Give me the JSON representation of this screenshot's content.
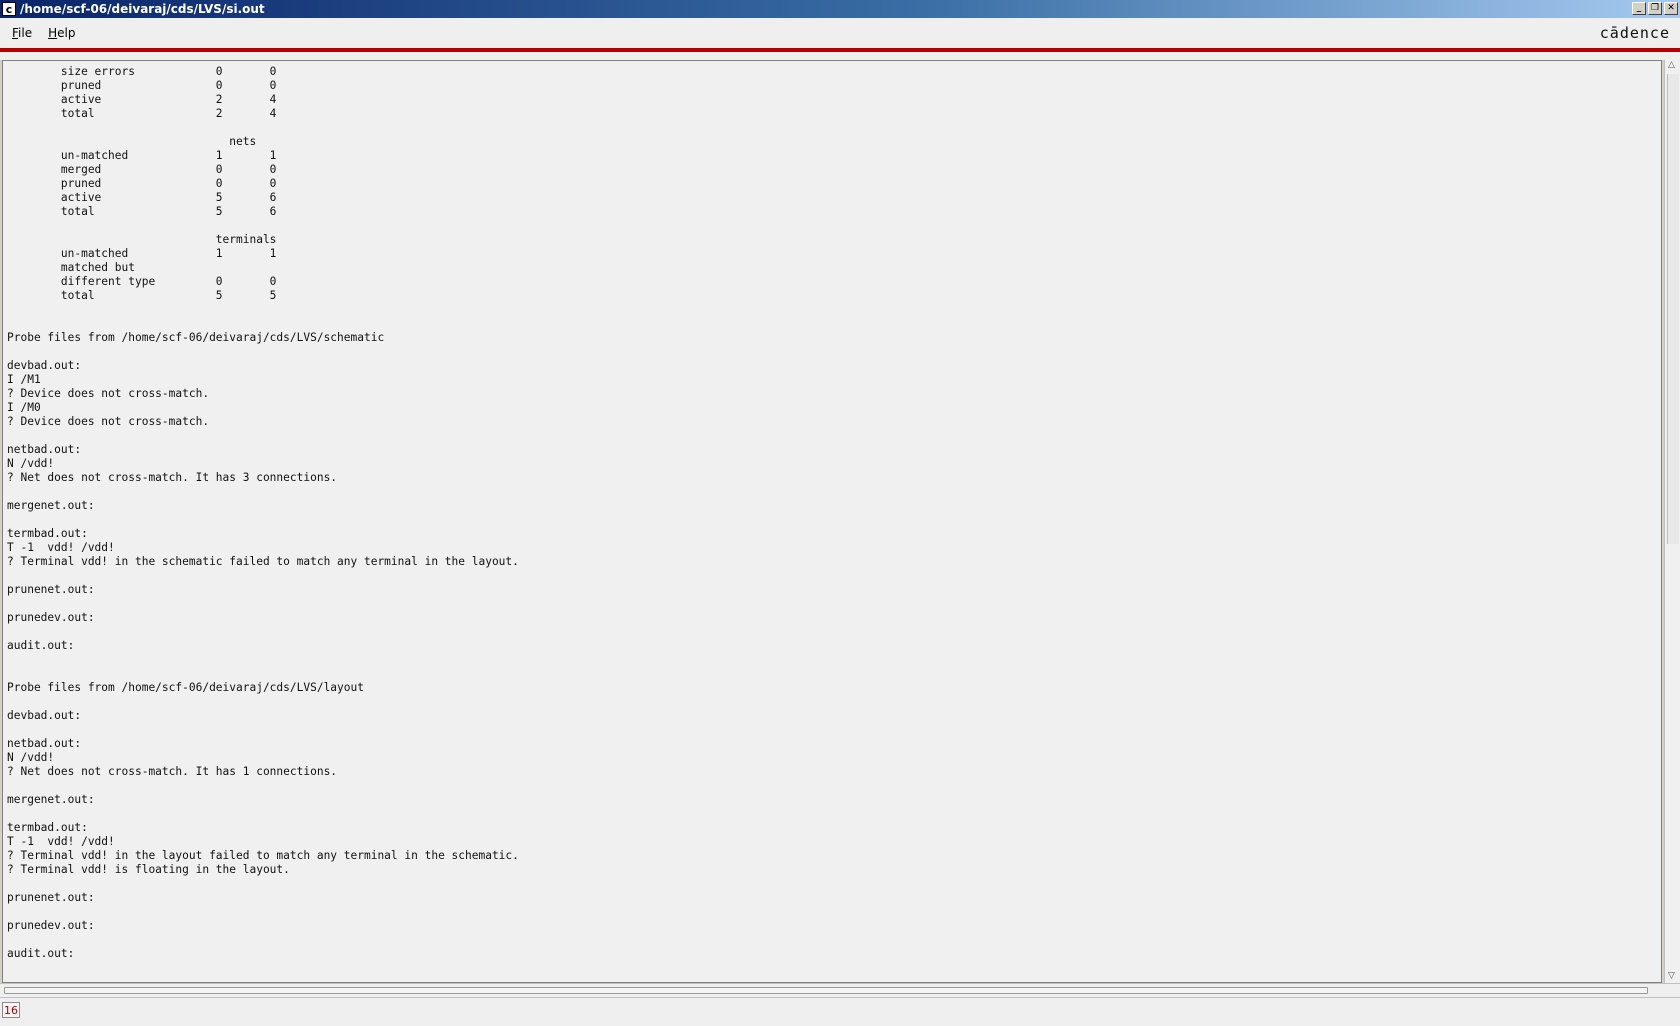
{
  "window": {
    "title": "/home/scf-06/deivaraj/cds/LVS/si.out",
    "app_icon": "c"
  },
  "menubar": {
    "file_label_first": "F",
    "file_label_rest": "ile",
    "help_label_first": "H",
    "help_label_rest": "elp",
    "brand": "cādence"
  },
  "content": {
    "lines": [
      "        size errors            0       0",
      "        pruned                 0       0",
      "        active                 2       4",
      "        total                  2       4",
      "",
      "                                 nets",
      "        un-matched             1       1",
      "        merged                 0       0",
      "        pruned                 0       0",
      "        active                 5       6",
      "        total                  5       6",
      "",
      "                               terminals",
      "        un-matched             1       1",
      "        matched but",
      "        different type         0       0",
      "        total                  5       5",
      "",
      "",
      "Probe files from /home/scf-06/deivaraj/cds/LVS/schematic",
      "",
      "devbad.out:",
      "I /M1",
      "? Device does not cross-match.",
      "I /M0",
      "? Device does not cross-match.",
      "",
      "netbad.out:",
      "N /vdd!",
      "? Net does not cross-match. It has 3 connections.",
      "",
      "mergenet.out:",
      "",
      "termbad.out:",
      "T -1  vdd! /vdd!",
      "? Terminal vdd! in the schematic failed to match any terminal in the layout.",
      "",
      "prunenet.out:",
      "",
      "prunedev.out:",
      "",
      "audit.out:",
      "",
      "",
      "Probe files from /home/scf-06/deivaraj/cds/LVS/layout",
      "",
      "devbad.out:",
      "",
      "netbad.out:",
      "N /vdd!",
      "? Net does not cross-match. It has 1 connections.",
      "",
      "mergenet.out:",
      "",
      "termbad.out:",
      "T -1  vdd! /vdd!",
      "? Terminal vdd! in the layout failed to match any terminal in the schematic.",
      "? Terminal vdd! is floating in the layout.",
      "",
      "prunenet.out:",
      "",
      "prunedev.out:",
      "",
      "audit.out:"
    ]
  },
  "statusbar": {
    "line_count": "16"
  }
}
